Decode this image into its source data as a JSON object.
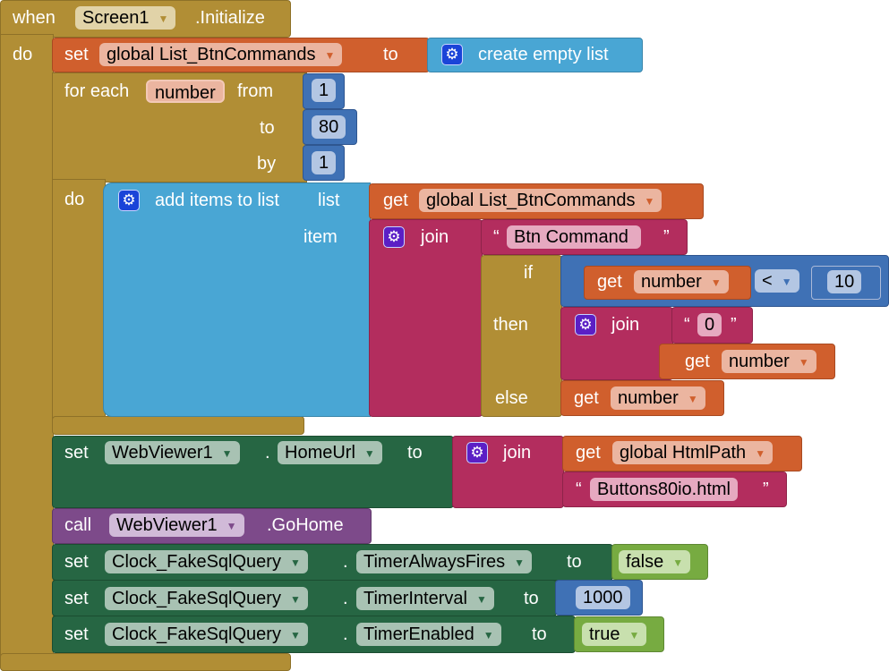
{
  "colors": {
    "control": "#b18e35",
    "variable": "#d05f2d",
    "list": "#49a6d4",
    "math": "#3f71b5",
    "text": "#b32d5e",
    "component_set": "#266643",
    "component_call": "#7d4a8a",
    "logic": "#77ab41"
  },
  "event": {
    "when": "when",
    "component": "Screen1",
    "event": ".Initialize",
    "do": "do"
  },
  "set_list": {
    "set": "set",
    "var": "global List_BtnCommands",
    "to": "to",
    "create": "create empty list",
    "icon": "gear-icon"
  },
  "for_each": {
    "label": "for each",
    "var": "number",
    "from": "from",
    "to": "to",
    "by": "by",
    "do": "do",
    "from_val": "1",
    "to_val": "80",
    "by_val": "1"
  },
  "add_items": {
    "label": "add items to list",
    "list": "list",
    "item": "item",
    "get": "get",
    "var": "global List_BtnCommands"
  },
  "join1": {
    "label": "join",
    "open": "“",
    "close": "”",
    "text": "Btn Command"
  },
  "if_block": {
    "if": "if",
    "then": "then",
    "else": "else"
  },
  "compare": {
    "get": "get",
    "var": "number",
    "op": "<",
    "value": "10"
  },
  "join2": {
    "label": "join",
    "open": "“",
    "close": "”",
    "text": "0",
    "get": "get",
    "var": "number"
  },
  "else_get": {
    "get": "get",
    "var": "number"
  },
  "webviewer_set": {
    "set": "set",
    "component": "WebViewer1",
    "dot": ".",
    "prop": "HomeUrl",
    "to": "to",
    "join": "join",
    "get": "get",
    "var": "global HtmlPath",
    "open": "“",
    "close": "”",
    "text": "Buttons80io.html"
  },
  "call": {
    "call": "call",
    "component": "WebViewer1",
    "method": ".GoHome"
  },
  "clock_rows": [
    {
      "set": "set",
      "component": "Clock_FakeSqlQuery",
      "dot": ".",
      "prop": "TimerAlwaysFires",
      "to": "to",
      "value": "false"
    },
    {
      "set": "set",
      "component": "Clock_FakeSqlQuery",
      "dot": ".",
      "prop": "TimerInterval",
      "to": "to",
      "value": "1000"
    },
    {
      "set": "set",
      "component": "Clock_FakeSqlQuery",
      "dot": ".",
      "prop": "TimerEnabled",
      "to": "to",
      "value": "true"
    }
  ]
}
